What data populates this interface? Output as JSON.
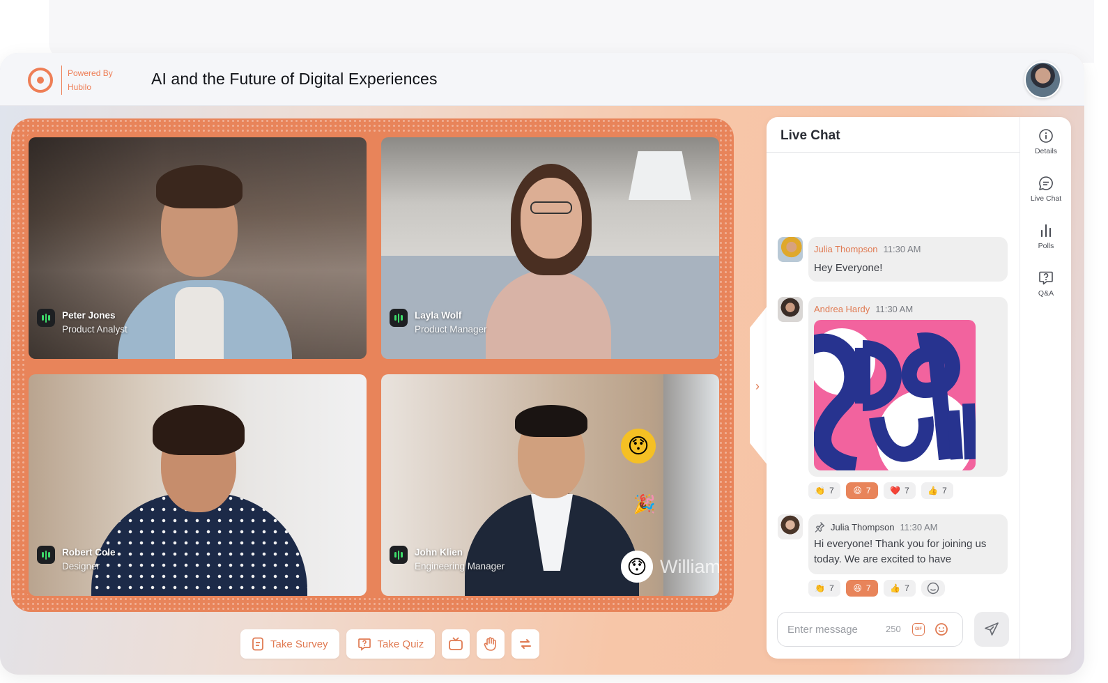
{
  "header": {
    "powered_line1": "Powered By",
    "powered_line2": "Hubilo",
    "event_title": "AI and the Future of Digital Experiences"
  },
  "participants": [
    {
      "name": "Peter Jones",
      "role": "Product Analyst"
    },
    {
      "name": "Layla Wolf",
      "role": "Product Manager"
    },
    {
      "name": "Robert Cole",
      "role": "Designer"
    },
    {
      "name": "John Klien",
      "role": "Engineering Manager"
    }
  ],
  "overlay_name": "William",
  "actions": {
    "survey_label": "Take Survey",
    "quiz_label": "Take Quiz"
  },
  "chat": {
    "title": "Live Chat",
    "messages": [
      {
        "author": "Julia Thompson",
        "time": "11:30 AM",
        "text": "Hey Everyone!"
      },
      {
        "author": "Andrea Hardy",
        "time": "11:30 AM",
        "text": ""
      },
      {
        "author": "Julia Thompson",
        "time": "11:30 AM",
        "text": "Hi everyone! Thank you for joining us today. We are excited to have"
      }
    ],
    "reactions_a": [
      {
        "emoji": "👏",
        "count": "7"
      },
      {
        "emoji": "😆",
        "count": "7"
      },
      {
        "emoji": "❤️",
        "count": "7"
      },
      {
        "emoji": "👍",
        "count": "7"
      }
    ],
    "reactions_b": [
      {
        "emoji": "👏",
        "count": "7"
      },
      {
        "emoji": "😆",
        "count": "7"
      },
      {
        "emoji": "👍",
        "count": "7"
      }
    ],
    "composer": {
      "placeholder": "Enter message",
      "char_limit": "250",
      "gif_label": "GIF"
    }
  },
  "rail": {
    "details": "Details",
    "live_chat": "Live Chat",
    "polls": "Polls",
    "qa": "Q&A"
  },
  "colors": {
    "accent": "#e8845a",
    "mic_active": "#3ddc6a",
    "sticker_bg": "#f2639e"
  }
}
